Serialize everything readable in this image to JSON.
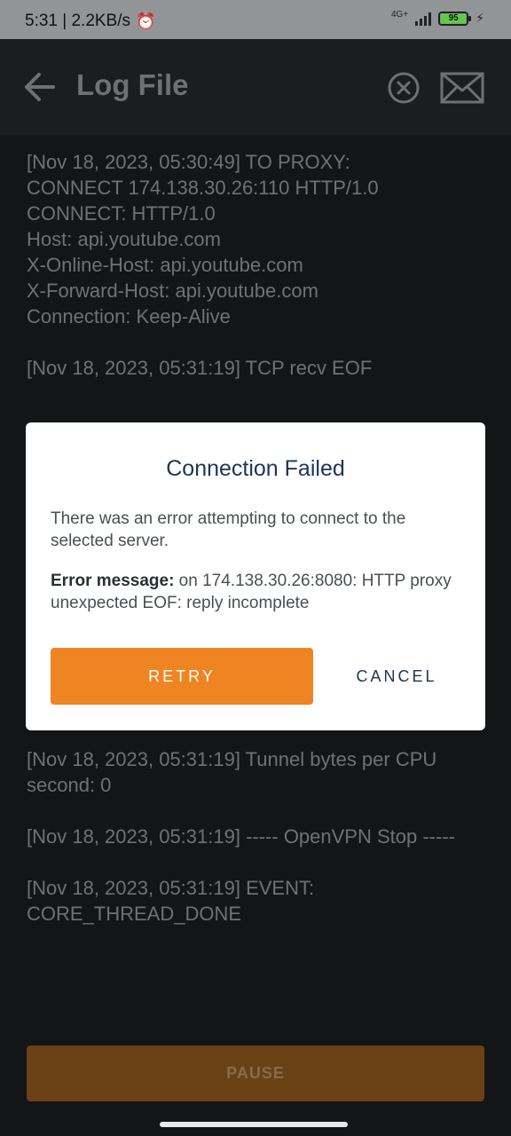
{
  "status_bar": {
    "time_speed": "5:31 | 2.2KB/s",
    "alarm_icon": "alarm-icon",
    "network": "4G+",
    "battery": "95"
  },
  "app_bar": {
    "title": "Log File",
    "back_icon": "arrow-left-icon",
    "clear_icon": "circle-x-icon",
    "email_icon": "envelope-icon"
  },
  "log": {
    "top_entries": [
      "[Nov 18, 2023, 05:30:49] TO PROXY:\nCONNECT 174.138.30.26:110 HTTP/1.0\nCONNECT: HTTP/1.0\nHost: api.youtube.com\nX-Online-Host: api.youtube.com\nX-Forward-Host: api.youtube.com\nConnection: Keep-Alive",
      "",
      "[Nov 18, 2023, 05:31:19] TCP recv EOF"
    ],
    "bottom_entries": [
      "[Nov 18, 2023, 05:31:19] Tunnel bytes per CPU second: 0",
      "[Nov 18, 2023, 05:31:19] ----- OpenVPN Stop -----",
      "[Nov 18, 2023, 05:31:19] EVENT: CORE_THREAD_DONE"
    ]
  },
  "dialog": {
    "title": "Connection Failed",
    "body": "There was an error attempting to connect to the selected server.",
    "error_label": "Error message:",
    "error_text": " on 174.138.30.26:8080: HTTP proxy unexpected EOF: reply incomplete",
    "retry_label": "RETRY",
    "cancel_label": "CANCEL"
  },
  "pause_label": "PAUSE",
  "colors": {
    "accent": "#ee8522",
    "dialog_title": "#1d3557",
    "background": "#131516"
  }
}
